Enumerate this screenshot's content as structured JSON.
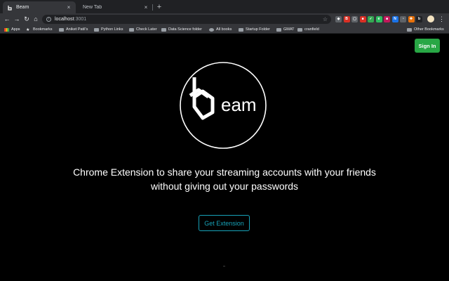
{
  "browser": {
    "tabs": [
      {
        "title": "Beam",
        "favicon": "beam-favicon",
        "close": "×",
        "active": true
      },
      {
        "title": "New Tab",
        "close": "×",
        "active": false
      }
    ],
    "new_tab_symbol": "+",
    "nav": {
      "back": "←",
      "forward": "→",
      "reload": "↻",
      "home": "⌂"
    },
    "omnibox": {
      "host": "localhost",
      "port": ":3001",
      "info": "i",
      "star": "☆"
    },
    "extensions": [
      {
        "name": "shield-ext",
        "color": "#5f6368",
        "label": "◆"
      },
      {
        "name": "adblock-ext",
        "color": "#d93025",
        "label": "B"
      },
      {
        "name": "pocket-ext",
        "color": "#5f6368",
        "label": "▢"
      },
      {
        "name": "red-ext",
        "color": "#d93025",
        "label": "■"
      },
      {
        "name": "tick-ext",
        "color": "#34a853",
        "label": "✓"
      },
      {
        "name": "evernote-ext",
        "color": "#2dbe60",
        "label": "e"
      },
      {
        "name": "pink-ext",
        "color": "#c2185b",
        "label": "■"
      },
      {
        "name": "blue-ext",
        "color": "#1a73e8",
        "label": "N"
      },
      {
        "name": "ghost-ext",
        "color": "#5f6368",
        "label": "◔"
      },
      {
        "name": "orange-ext",
        "color": "#e8710a",
        "label": "✚"
      },
      {
        "name": "dark-ext",
        "color": "#202124",
        "label": "b"
      }
    ],
    "menu_symbol": "⋮",
    "bookmarks": [
      {
        "label": "Apps",
        "icon": "apps-grid-icon"
      },
      {
        "label": "Bookmarks",
        "icon": "star-icon"
      },
      {
        "label": "Aniket Patil's",
        "icon": "folder-icon"
      },
      {
        "label": "Python Links",
        "icon": "folder-icon"
      },
      {
        "label": "Check Later",
        "icon": "folder-icon"
      },
      {
        "label": "Data Science folder",
        "icon": "folder-icon"
      },
      {
        "label": "All books",
        "icon": "books-icon"
      },
      {
        "label": "Startup Folder",
        "icon": "folder-icon"
      },
      {
        "label": "GMAT",
        "icon": "folder-icon"
      },
      {
        "label": "cranfield",
        "icon": "folder-icon"
      }
    ],
    "other_bookmarks": "Other Bookmarks"
  },
  "page": {
    "signin_label": "Sign In",
    "logo_text": "eam",
    "headline_line1": "Chrome Extension to share your streaming accounts with your friends",
    "headline_line2": "without giving out your passwords",
    "cta_label": "Get Extension",
    "colors": {
      "signin": "#28a745",
      "cta": "#17a2b8",
      "background": "#000000"
    }
  }
}
